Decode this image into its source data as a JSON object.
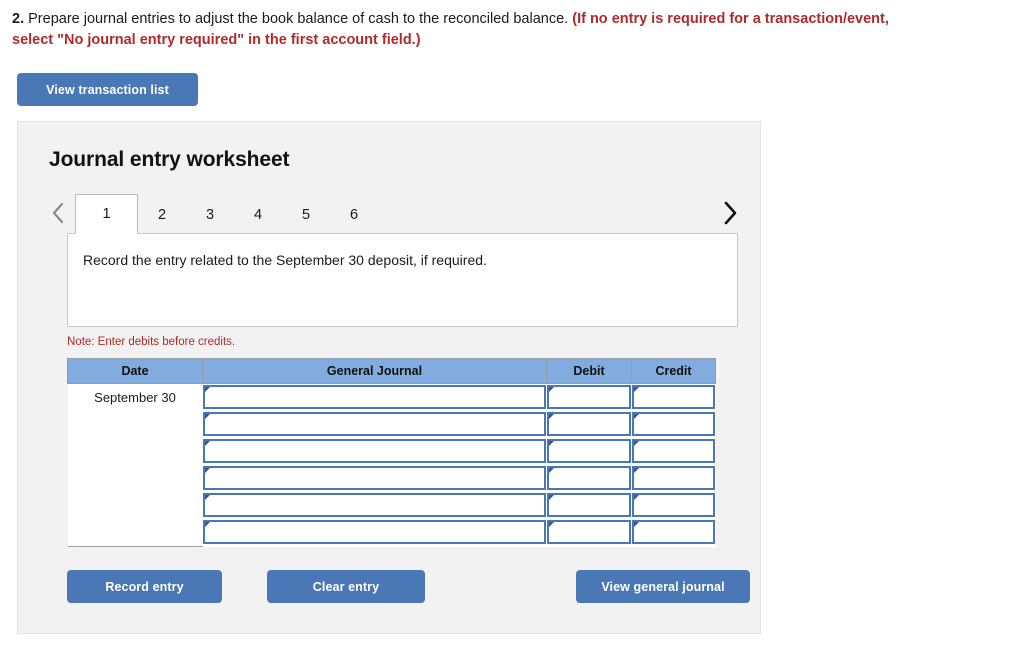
{
  "question": {
    "number": "2.",
    "text": "Prepare journal entries to adjust the book balance of cash to the reconciled balance.",
    "note": "(If no entry is required for a transaction/event, select \"No journal entry required\" in the first account field.)"
  },
  "toolbar": {
    "view_transaction_list": "View transaction list"
  },
  "panel": {
    "title": "Journal entry worksheet"
  },
  "tabs": {
    "prev_label": "‹",
    "next_label": "›",
    "items": [
      {
        "label": "1",
        "active": true
      },
      {
        "label": "2",
        "active": false
      },
      {
        "label": "3",
        "active": false
      },
      {
        "label": "4",
        "active": false
      },
      {
        "label": "5",
        "active": false
      },
      {
        "label": "6",
        "active": false
      }
    ]
  },
  "instruction": {
    "text": "Record the entry related to the September 30 deposit, if required."
  },
  "note": "Note: Enter debits before credits.",
  "table": {
    "headers": [
      "Date",
      "General Journal",
      "Debit",
      "Credit"
    ],
    "rows": [
      {
        "date": "September 30",
        "general_journal": "",
        "debit": "",
        "credit": ""
      },
      {
        "date": "",
        "general_journal": "",
        "debit": "",
        "credit": ""
      },
      {
        "date": "",
        "general_journal": "",
        "debit": "",
        "credit": ""
      },
      {
        "date": "",
        "general_journal": "",
        "debit": "",
        "credit": ""
      },
      {
        "date": "",
        "general_journal": "",
        "debit": "",
        "credit": ""
      },
      {
        "date": "",
        "general_journal": "",
        "debit": "",
        "credit": ""
      }
    ]
  },
  "actions": {
    "record_entry": "Record entry",
    "clear_entry": "Clear entry",
    "view_general_journal": "View general journal"
  },
  "colors": {
    "accent_blue": "#4a77b5",
    "header_blue": "#82ace0",
    "note_red": "#b02a2a",
    "panel_bg": "#f2f2f2"
  }
}
